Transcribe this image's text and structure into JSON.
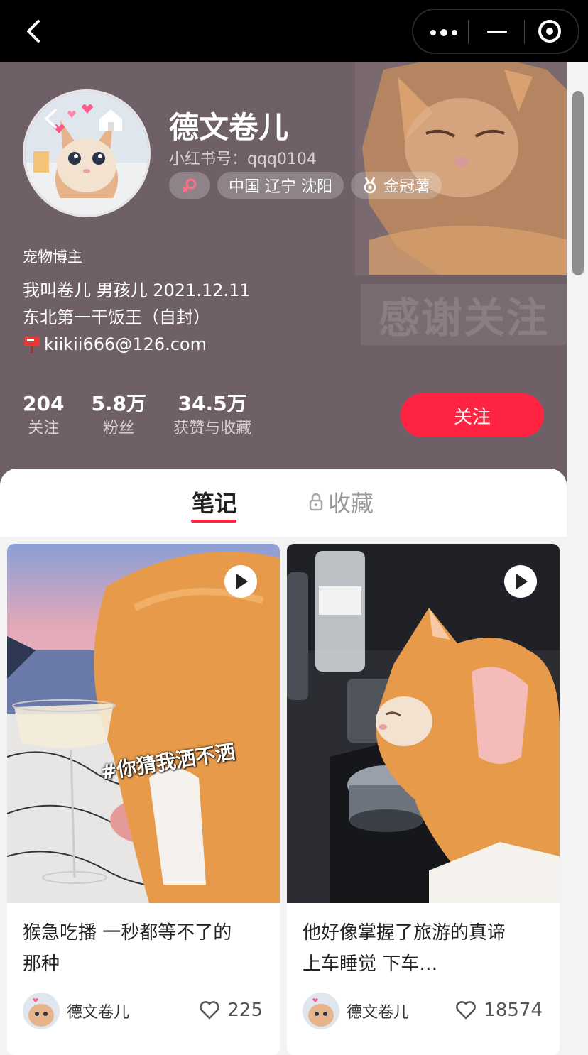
{
  "profile": {
    "name": "德文卷儿",
    "red_id": "小红书号：qqq0104",
    "location_tag": "中国 辽宁 沈阳",
    "level_tag": "金冠薯",
    "category": "宠物博主",
    "bio_line1": "我叫卷儿 男孩儿 2021.12.11",
    "bio_line2": "东北第一干饭王（自封）",
    "bio_line3": "kiikii666@126.com",
    "background_sign": "感谢关注",
    "stats": [
      {
        "value": "204",
        "label": "关注"
      },
      {
        "value": "5.8万",
        "label": "粉丝"
      },
      {
        "value": "34.5万",
        "label": "获赞与收藏"
      }
    ],
    "follow_label": "关注"
  },
  "tabs": {
    "notes": "笔记",
    "favorites": "收藏"
  },
  "cards": [
    {
      "title_line1": "猴急吃播 一秒都等不了的",
      "title_line2": "那种",
      "overlay": "#你猜我洒不洒",
      "author": "德文卷儿",
      "likes": "225"
    },
    {
      "title_line1": "他好像掌握了旅游的真谛",
      "title_line2": "上车睡觉 下车…",
      "author": "德文卷儿",
      "likes": "18574"
    }
  ],
  "icons": [
    "back-icon",
    "more-icon",
    "minimize-icon",
    "close-target-icon",
    "home-icon",
    "gender-icon",
    "medal-icon",
    "mailbox-icon",
    "lock-icon",
    "play-icon",
    "heart-icon"
  ],
  "colors": {
    "accent": "#ff2442",
    "header_bg": "#6f6068",
    "cat_orange": "#e79a4a"
  }
}
